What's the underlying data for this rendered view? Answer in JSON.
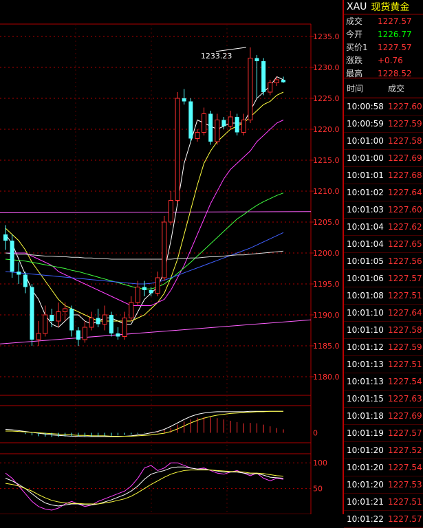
{
  "header": {
    "symbol": "XAU",
    "name": "现货黄金"
  },
  "quote": [
    {
      "label": "成交",
      "value": "1227.57",
      "color": "red"
    },
    {
      "label": "今开",
      "value": "1226.77",
      "color": "green"
    },
    {
      "label": "买价1",
      "value": "1227.57",
      "color": "red"
    },
    {
      "label": "涨跌",
      "value": "+0.76",
      "color": "red"
    },
    {
      "label": "最高",
      "value": "1228.52",
      "color": "red"
    }
  ],
  "trades": {
    "col_time": "时间",
    "col_price": "成交",
    "rows": [
      {
        "time": "10:00:58",
        "price": "1227.60"
      },
      {
        "time": "10:00:59",
        "price": "1227.59"
      },
      {
        "time": "10:01:00",
        "price": "1227.58"
      },
      {
        "time": "10:01:00",
        "price": "1227.69"
      },
      {
        "time": "10:01:01",
        "price": "1227.68"
      },
      {
        "time": "10:01:02",
        "price": "1227.64"
      },
      {
        "time": "10:01:03",
        "price": "1227.60"
      },
      {
        "time": "10:01:04",
        "price": "1227.62"
      },
      {
        "time": "10:01:04",
        "price": "1227.65"
      },
      {
        "time": "10:01:05",
        "price": "1227.56"
      },
      {
        "time": "10:01:06",
        "price": "1227.57"
      },
      {
        "time": "10:01:08",
        "price": "1227.51"
      },
      {
        "time": "10:01:10",
        "price": "1227.64"
      },
      {
        "time": "10:01:10",
        "price": "1227.58"
      },
      {
        "time": "10:01:12",
        "price": "1227.59"
      },
      {
        "time": "10:01:13",
        "price": "1227.51"
      },
      {
        "time": "10:01:13",
        "price": "1227.54"
      },
      {
        "time": "10:01:15",
        "price": "1227.63"
      },
      {
        "time": "10:01:18",
        "price": "1227.69"
      },
      {
        "time": "10:01:19",
        "price": "1227.57"
      },
      {
        "time": "10:01:20",
        "price": "1227.52"
      },
      {
        "time": "10:01:20",
        "price": "1227.54"
      },
      {
        "time": "10:01:20",
        "price": "1227.53"
      },
      {
        "time": "10:01:21",
        "price": "1227.51"
      },
      {
        "time": "10:01:22",
        "price": "1227.57"
      }
    ]
  },
  "colors": {
    "up": "#ff3030",
    "down": "#54ffff",
    "grid": "#b00000",
    "axis_text": "#ff3030",
    "ma5": "#ffffff",
    "ma10": "#ffff40",
    "ma20": "#ff40ff",
    "ma40": "#40ff40",
    "ma60": "#4060ff",
    "ma120": "#dddddd",
    "trend": "#ff60ff"
  },
  "chart_data": [
    {
      "type": "candlestick",
      "ylim": [
        1177,
        1237
      ],
      "yticks": [
        1180.0,
        1185.0,
        1190.0,
        1195.0,
        1200.0,
        1205.0,
        1210.0,
        1215.0,
        1220.0,
        1225.0,
        1230.0,
        1235.0
      ],
      "grid": true,
      "annotations": [
        {
          "text": "1233.23",
          "value": 1233.23
        }
      ],
      "candles": [
        [
          1203,
          1202,
          1204.5,
          1200.5
        ],
        [
          1202,
          1197,
          1203,
          1196
        ],
        [
          1197,
          1196.5,
          1198.5,
          1195
        ],
        [
          1196.5,
          1194.5,
          1197,
          1193.5
        ],
        [
          1194.5,
          1186,
          1195,
          1185
        ],
        [
          1186,
          1187,
          1189,
          1185
        ],
        [
          1187,
          1190,
          1191.5,
          1186.5
        ],
        [
          1190,
          1189,
          1191,
          1188
        ],
        [
          1189,
          1190.5,
          1192,
          1188
        ],
        [
          1190.5,
          1191,
          1192,
          1189
        ],
        [
          1191,
          1187.5,
          1191.5,
          1186.5
        ],
        [
          1187.5,
          1186,
          1188,
          1185
        ],
        [
          1186,
          1188,
          1189,
          1185.5
        ],
        [
          1188,
          1189.5,
          1190.5,
          1187.5
        ],
        [
          1189.5,
          1188.5,
          1191,
          1188
        ],
        [
          1188.5,
          1190,
          1191.5,
          1187.5
        ],
        [
          1190,
          1187,
          1190.5,
          1186.5
        ],
        [
          1187,
          1186.5,
          1188,
          1186
        ],
        [
          1186.5,
          1189.5,
          1190.5,
          1186
        ],
        [
          1189.5,
          1192,
          1193,
          1189
        ],
        [
          1192,
          1194.5,
          1195.5,
          1191.5
        ],
        [
          1194.5,
          1194,
          1195.5,
          1193
        ],
        [
          1194,
          1193.5,
          1194.5,
          1193
        ],
        [
          1193.5,
          1196,
          1197,
          1193
        ],
        [
          1196,
          1205,
          1206,
          1195.5
        ],
        [
          1205,
          1208.5,
          1210,
          1204.5
        ],
        [
          1208.5,
          1225,
          1226,
          1208
        ],
        [
          1225,
          1224.5,
          1226.5,
          1224
        ],
        [
          1224.5,
          1218.5,
          1225,
          1218
        ],
        [
          1218.5,
          1219.5,
          1220,
          1218
        ],
        [
          1219.5,
          1222.5,
          1223.5,
          1219
        ],
        [
          1222.5,
          1218,
          1223,
          1217.5
        ],
        [
          1218,
          1221.5,
          1222.5,
          1217.5
        ],
        [
          1221.5,
          1220.5,
          1222,
          1220
        ],
        [
          1220.5,
          1222,
          1223,
          1220
        ],
        [
          1222,
          1219.5,
          1222.5,
          1219
        ],
        [
          1219.5,
          1221.5,
          1222.5,
          1219
        ],
        [
          1221.5,
          1231.5,
          1233.23,
          1221
        ],
        [
          1231.5,
          1231,
          1232,
          1225
        ],
        [
          1231,
          1226,
          1231.5,
          1225.5
        ],
        [
          1226,
          1227.5,
          1228,
          1225.5
        ],
        [
          1227.5,
          1228,
          1228.5,
          1227
        ],
        [
          1228,
          1227.6,
          1228.5,
          1227.5
        ]
      ],
      "ma_lines": [
        {
          "name": "MA5",
          "values": [
            1203,
            1201.5,
            1199,
            1196.5,
            1194,
            1192.5,
            1190,
            1188.5,
            1188,
            1189,
            1190,
            1190,
            1189,
            1188.5,
            1189,
            1189.5,
            1189.5,
            1189,
            1188.5,
            1188.5,
            1190.5,
            1192.5,
            1193.5,
            1194.5,
            1197,
            1202,
            1208,
            1214.5,
            1218,
            1221.5,
            1221,
            1220.5,
            1220,
            1220.5,
            1221,
            1221,
            1221,
            1223,
            1225,
            1226,
            1227,
            1228.5,
            1228
          ]
        },
        {
          "name": "MA10",
          "values": [
            1204,
            1203,
            1202,
            1200.5,
            1198.5,
            1197,
            1195.5,
            1194,
            1192.5,
            1191.5,
            1191,
            1190.5,
            1190,
            1189.5,
            1189,
            1189,
            1189,
            1189,
            1189,
            1189,
            1189.5,
            1190,
            1191,
            1192,
            1193.5,
            1196,
            1199,
            1203,
            1207,
            1211,
            1214.5,
            1216.5,
            1218,
            1219,
            1220,
            1220.5,
            1221,
            1222,
            1223,
            1224,
            1224.5,
            1225.5,
            1226
          ]
        },
        {
          "name": "MA20",
          "values": [
            1200,
            1200,
            1200,
            1200,
            1199.5,
            1199,
            1198.5,
            1198,
            1197,
            1196.5,
            1196,
            1195.5,
            1195,
            1194.5,
            1194,
            1193.5,
            1193,
            1192.5,
            1192,
            1191.5,
            1191.5,
            1191.5,
            1191.5,
            1192,
            1192.5,
            1194,
            1196,
            1198,
            1200.5,
            1203,
            1205.5,
            1208,
            1210,
            1212,
            1213.5,
            1214.5,
            1215.5,
            1216.5,
            1218,
            1219,
            1220,
            1221,
            1221.5
          ]
        },
        {
          "name": "MA40",
          "values": [
            1199,
            1198.9,
            1198.8,
            1198.7,
            1198.5,
            1198.3,
            1198.1,
            1197.9,
            1197.7,
            1197.5,
            1197.2,
            1197,
            1196.7,
            1196.4,
            1196.1,
            1195.8,
            1195.5,
            1195.2,
            1194.9,
            1194.6,
            1194.3,
            1194.2,
            1194.2,
            1194.5,
            1195,
            1195.8,
            1196.7,
            1197.6,
            1198.5,
            1199.5,
            1200.5,
            1201.5,
            1202.5,
            1203.5,
            1204.5,
            1205.5,
            1206.2,
            1207,
            1207.7,
            1208.3,
            1208.8,
            1209.3,
            1209.7
          ]
        },
        {
          "name": "MA60",
          "values": [
            1197,
            1196.9,
            1196.8,
            1196.7,
            1196.6,
            1196.5,
            1196.4,
            1196.3,
            1196.2,
            1196.1,
            1196,
            1195.9,
            1195.8,
            1195.7,
            1195.6,
            1195.5,
            1195.4,
            1195.3,
            1195.2,
            1195.1,
            1195,
            1195,
            1195.1,
            1195.3,
            1195.6,
            1196,
            1196.4,
            1196.8,
            1197.2,
            1197.6,
            1198,
            1198.4,
            1198.8,
            1199.2,
            1199.6,
            1200,
            1200.4,
            1200.8,
            1201.3,
            1201.8,
            1202.3,
            1202.8,
            1203.3
          ]
        },
        {
          "name": "MA120",
          "values": [
            1200,
            1199.9,
            1199.8,
            1199.8,
            1199.7,
            1199.6,
            1199.5,
            1199.5,
            1199.4,
            1199.4,
            1199.3,
            1199.3,
            1199.2,
            1199.2,
            1199.1,
            1199.1,
            1199,
            1199,
            1199,
            1199,
            1199,
            1199,
            1199,
            1199,
            1199,
            1199,
            1199.1,
            1199.1,
            1199.2,
            1199.2,
            1199.3,
            1199.4,
            1199.4,
            1199.5,
            1199.6,
            1199.7,
            1199.7,
            1199.8,
            1199.9,
            1200,
            1200.1,
            1200.2,
            1200.3
          ]
        }
      ],
      "trend_lines": [
        {
          "from": [
            0,
            1206.5
          ],
          "to": [
            42.5,
            1206.7
          ]
        },
        {
          "from": [
            0,
            1185.3
          ],
          "to": [
            42.5,
            1189.2
          ]
        }
      ]
    },
    {
      "type": "bar",
      "name": "MACD",
      "yticks": [
        0
      ],
      "values": [
        0,
        0,
        0,
        -0.3,
        -0.6,
        -0.8,
        -0.9,
        -1,
        -1,
        -0.9,
        -0.9,
        -0.9,
        -0.9,
        -0.9,
        -0.8,
        -0.7,
        -0.7,
        -0.6,
        -0.5,
        -0.4,
        -0.2,
        -0.1,
        0.1,
        0.3,
        0.7,
        1.2,
        1.9,
        2.6,
        3.1,
        3.5,
        3.7,
        3.6,
        3.4,
        3.1,
        2.8,
        2.5,
        2.2,
        2.3,
        2.2,
        1.9,
        1.5,
        1.1,
        0.8
      ],
      "line1": [
        0.8,
        0.7,
        0.5,
        0.3,
        0.1,
        -0.1,
        -0.3,
        -0.5,
        -0.6,
        -0.7,
        -0.8,
        -0.8,
        -0.9,
        -0.9,
        -0.9,
        -0.9,
        -0.9,
        -0.9,
        -0.8,
        -0.7,
        -0.5,
        -0.3,
        0,
        0.3,
        0.8,
        1.5,
        2.3,
        3.1,
        3.8,
        4.3,
        4.6,
        4.8,
        4.9,
        4.9,
        4.9,
        4.9,
        4.9,
        5,
        5,
        5,
        5,
        5,
        5
      ],
      "line2": [
        0.4,
        0.4,
        0.3,
        0.2,
        0.1,
        0,
        -0.1,
        -0.2,
        -0.3,
        -0.4,
        -0.5,
        -0.6,
        -0.6,
        -0.7,
        -0.7,
        -0.7,
        -0.8,
        -0.8,
        -0.8,
        -0.8,
        -0.7,
        -0.6,
        -0.5,
        -0.3,
        -0.1,
        0.3,
        0.9,
        1.6,
        2.3,
        2.9,
        3.4,
        3.8,
        4.1,
        4.3,
        4.5,
        4.6,
        4.7,
        4.8,
        4.9,
        4.9,
        5,
        5,
        5
      ],
      "ylim": [
        -2,
        6
      ]
    },
    {
      "type": "line",
      "name": "KDJ",
      "yticks": [
        50,
        100
      ],
      "ylim": [
        0,
        115
      ],
      "series": [
        {
          "color_key": "ma20",
          "values": [
            80,
            70,
            55,
            40,
            25,
            15,
            10,
            8,
            12,
            20,
            25,
            20,
            15,
            18,
            25,
            30,
            35,
            40,
            45,
            55,
            70,
            90,
            95,
            85,
            90,
            100,
            100,
            95,
            90,
            88,
            90,
            85,
            80,
            78,
            82,
            85,
            80,
            75,
            80,
            70,
            65,
            70,
            68
          ]
        },
        {
          "color_key": "ma5",
          "values": [
            70,
            65,
            58,
            50,
            40,
            30,
            22,
            18,
            16,
            18,
            20,
            20,
            18,
            18,
            20,
            24,
            28,
            33,
            38,
            45,
            55,
            68,
            78,
            82,
            85,
            90,
            92,
            92,
            90,
            88,
            88,
            86,
            84,
            82,
            82,
            82,
            80,
            78,
            79,
            76,
            72,
            71,
            70
          ]
        },
        {
          "color_key": "ma10",
          "values": [
            60,
            58,
            55,
            50,
            45,
            38,
            32,
            27,
            24,
            22,
            21,
            21,
            20,
            20,
            20,
            22,
            24,
            27,
            30,
            35,
            42,
            50,
            58,
            65,
            72,
            78,
            82,
            85,
            86,
            86,
            86,
            86,
            85,
            84,
            83,
            83,
            82,
            80,
            80,
            79,
            77,
            75,
            74
          ]
        }
      ]
    }
  ]
}
